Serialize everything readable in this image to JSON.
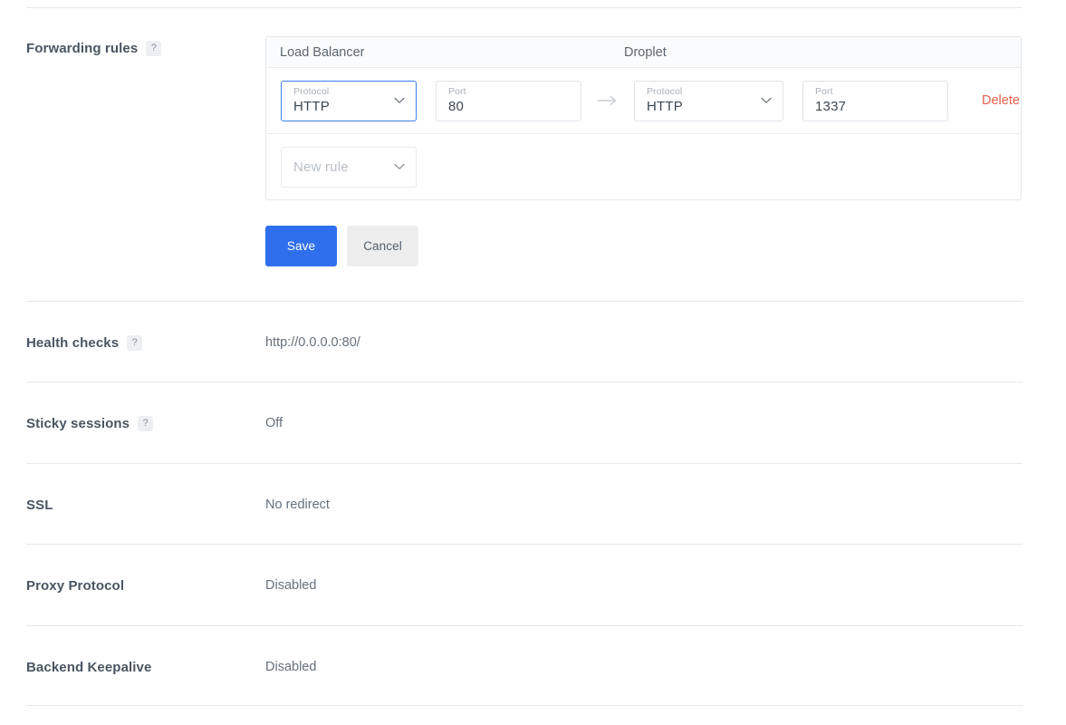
{
  "forwarding": {
    "label": "Forwarding rules",
    "help": "?",
    "columns": {
      "load_balancer": "Load Balancer",
      "droplet": "Droplet"
    },
    "rules": [
      {
        "lb_protocol_caption": "Protocol",
        "lb_protocol_value": "HTTP",
        "lb_port_caption": "Port",
        "lb_port_value": "80",
        "arrow": "arrow-right-icon",
        "droplet_protocol_caption": "Protocol",
        "droplet_protocol_value": "HTTP",
        "droplet_port_caption": "Port",
        "droplet_port_value": "1337",
        "delete_label": "Delete"
      }
    ],
    "new_rule_placeholder": "New rule",
    "save_label": "Save",
    "cancel_label": "Cancel"
  },
  "settings": [
    {
      "label": "Health checks",
      "help": "?",
      "value": "http://0.0.0.0:80/"
    },
    {
      "label": "Sticky sessions",
      "help": "?",
      "value": "Off"
    },
    {
      "label": "SSL",
      "help": null,
      "value": "No redirect"
    },
    {
      "label": "Proxy Protocol",
      "help": null,
      "value": "Disabled"
    },
    {
      "label": "Backend Keepalive",
      "help": null,
      "value": "Disabled"
    }
  ],
  "colors": {
    "primary": "#2f6fed",
    "danger": "#e8604c",
    "focus_border": "#3a7fe8",
    "divider": "#e5e8ec",
    "text": "#3d4852",
    "muted": "#66707b"
  }
}
